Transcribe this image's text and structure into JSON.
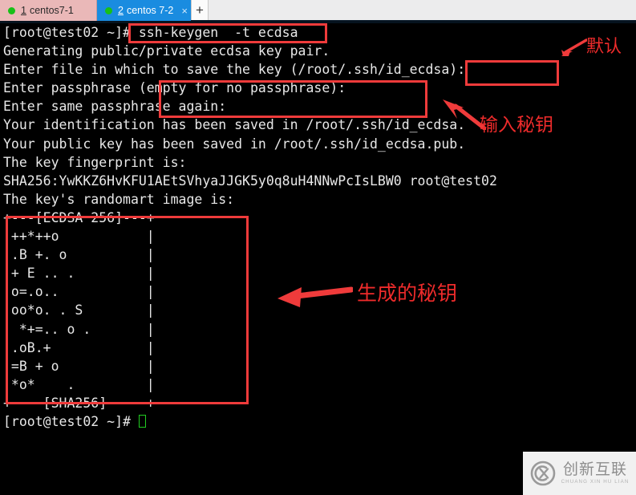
{
  "window": {
    "tabs": [
      {
        "num": "1",
        "label": "centos7-1",
        "active": false,
        "status_color": "#18c018"
      },
      {
        "num": "2",
        "label": "centos 7-2",
        "active": true,
        "status_color": "#18c018",
        "close_glyph": "×"
      }
    ],
    "new_tab_label": "+"
  },
  "terminal": {
    "lines": [
      "[root@test02 ~]# ssh-keygen  -t ecdsa",
      "Generating public/private ecdsa key pair.",
      "Enter file in which to save the key (/root/.ssh/id_ecdsa):",
      "Enter passphrase (empty for no passphrase):",
      "Enter same passphrase again:",
      "Your identification has been saved in /root/.ssh/id_ecdsa.",
      "Your public key has been saved in /root/.ssh/id_ecdsa.pub.",
      "The key fingerprint is:",
      "SHA256:YwKKZ6HvKFU1AEtSVhyaJJGK5y0q8uH4NNwPcIsLBW0 root@test02",
      "The key's randomart image is:",
      "+---[ECDSA 256]---+",
      "|++*++o           |",
      "|.B +. o          |",
      "|+ E .. .         |",
      "|o=.o..           |",
      "|oo*o. . S        |",
      "| *+=.. o .       |",
      "|.oB.+            |",
      "|=B + o           |",
      "|*o*    .         |",
      "+----[SHA256]-----+"
    ],
    "prompt": "[root@test02 ~]# ",
    "cursor": "block-cursor",
    "fg_color": "#e8e8e8",
    "bg_color": "#000000",
    "cursor_color": "#22cc22"
  },
  "annotations": {
    "box_color": "#ef3b3b",
    "text_color": "#ee2b2b",
    "items": [
      {
        "id": "command",
        "type": "box",
        "target": "ssh-keygen  -t ecdsa"
      },
      {
        "id": "default-value",
        "type": "box",
        "label": "默认"
      },
      {
        "id": "passphrase",
        "type": "box",
        "label": "输入秘钥"
      },
      {
        "id": "randomart",
        "type": "box",
        "label": "生成的秘钥"
      }
    ],
    "default_label": "默认",
    "input_label": "输入秘钥",
    "generated_label": "生成的秘钥"
  },
  "watermark": {
    "cn": "创新互联",
    "pinyin": "CHUANG XIN HU LIAN",
    "logo": "cx-circle-logo"
  }
}
